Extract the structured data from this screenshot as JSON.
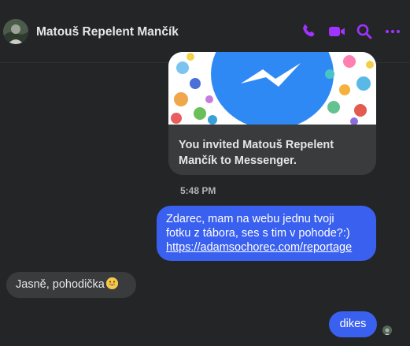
{
  "header": {
    "contact_name": "Matouš Repelent Mančík",
    "accent_color": "#a033ff",
    "actions": [
      {
        "icon": "phone-icon"
      },
      {
        "icon": "video-icon"
      },
      {
        "icon": "search-icon"
      },
      {
        "icon": "more-icon"
      }
    ]
  },
  "messages": {
    "invite_card": {
      "text": "You invited Matouš Repelent Mančík to Messenger.",
      "image_icon": "messenger-logo"
    },
    "timestamp": "5:48 PM",
    "outgoing_1": {
      "line1": "Zdarec, mam na webu jednu tvoji",
      "line2": "fotku z tábora, ses s tim v pohode?:)",
      "link": "https://adamsochorec.com/reportage",
      "bubble_color": "#3a60f0"
    },
    "incoming_1": {
      "text": "Jasně, pohodička",
      "emoji": "grinning-face"
    },
    "outgoing_2": {
      "text": "dikes"
    }
  }
}
